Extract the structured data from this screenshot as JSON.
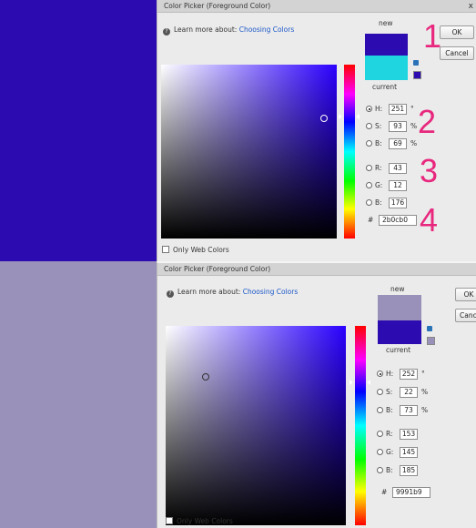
{
  "colors": {
    "left_top": "#2c0cb0",
    "left_bottom": "#9991b9",
    "hue_top": "#2c00ff",
    "hue_bottom": "#2a00ff",
    "current_top": "#1fd6e0",
    "accent_callout": "#e8287e"
  },
  "dialog1": {
    "title": "Color Picker (Foreground Color)",
    "close": "x",
    "learn_prefix": "Learn more about:",
    "learn_link": "Choosing Colors",
    "ok": "OK",
    "cancel": "Cancel",
    "new_label": "new",
    "current_label": "current",
    "fields": [
      {
        "label": "H:",
        "value": "251",
        "unit": "°",
        "selected": true
      },
      {
        "label": "S:",
        "value": "93",
        "unit": "%",
        "selected": false
      },
      {
        "label": "B:",
        "value": "69",
        "unit": "%",
        "selected": false
      },
      {
        "label": "R:",
        "value": "43",
        "unit": "",
        "selected": false
      },
      {
        "label": "G:",
        "value": "12",
        "unit": "",
        "selected": false
      },
      {
        "label": "B:",
        "value": "176",
        "unit": "",
        "selected": false
      }
    ],
    "hex_symbol": "#",
    "hex": "2b0cb0",
    "only_web": "Only Web Colors",
    "callouts": [
      "1",
      "2",
      "3",
      "4"
    ]
  },
  "dialog2": {
    "title": "Color Picker (Foreground Color)",
    "learn_prefix": "Learn more about:",
    "learn_link": "Choosing Colors",
    "ok": "OK",
    "cancel": "Canc",
    "new_label": "new",
    "current_label": "current",
    "fields": [
      {
        "label": "H:",
        "value": "252",
        "unit": "°",
        "selected": true
      },
      {
        "label": "S:",
        "value": "22",
        "unit": "%",
        "selected": false
      },
      {
        "label": "B:",
        "value": "73",
        "unit": "%",
        "selected": false
      },
      {
        "label": "R:",
        "value": "153",
        "unit": "",
        "selected": false
      },
      {
        "label": "G:",
        "value": "145",
        "unit": "",
        "selected": false
      },
      {
        "label": "B:",
        "value": "185",
        "unit": "",
        "selected": false
      }
    ],
    "hex_symbol": "#",
    "hex": "9991b9",
    "only_web": "Only Web Colors"
  }
}
